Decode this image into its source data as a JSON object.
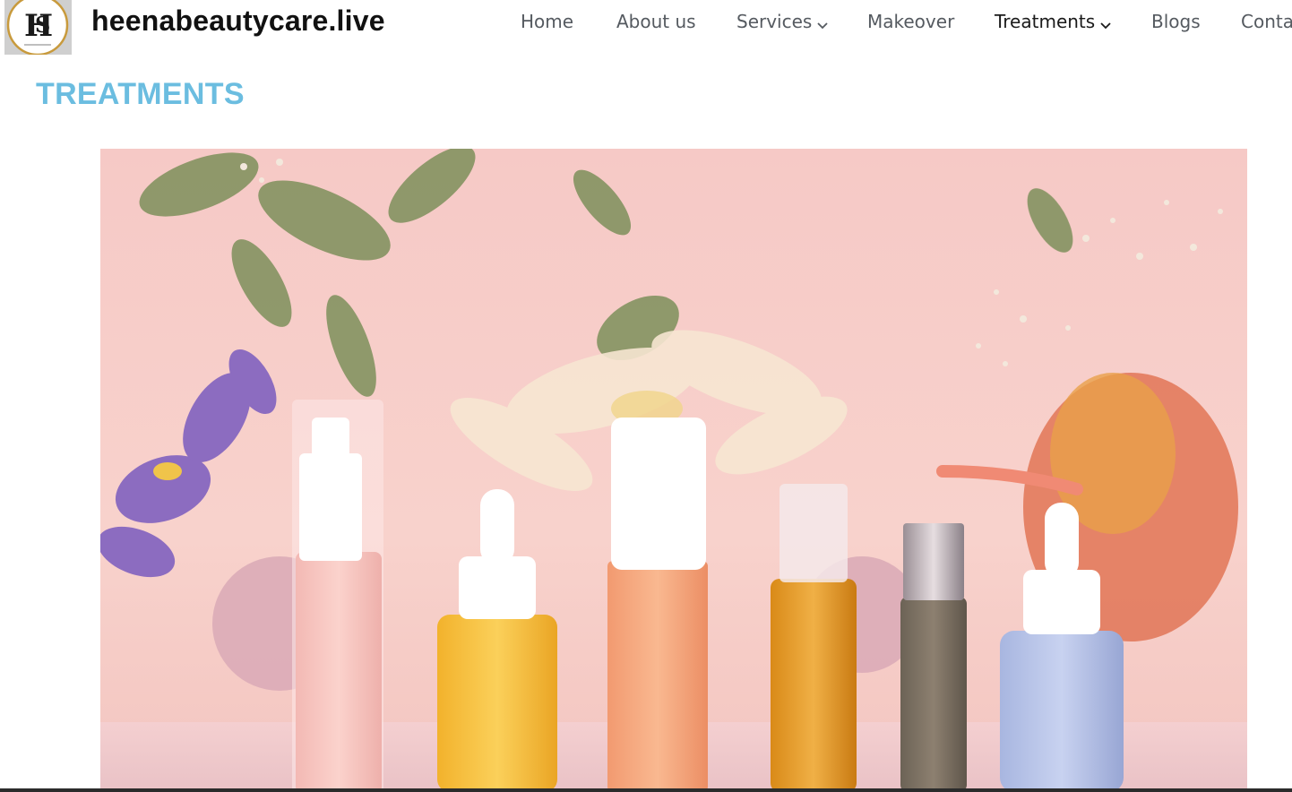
{
  "site": {
    "title": "heenabeautycare.live",
    "logo_alt": "HS beauty care logo"
  },
  "nav": {
    "items": [
      {
        "label": "Home",
        "has_dropdown": false
      },
      {
        "label": "About us",
        "has_dropdown": false
      },
      {
        "label": "Services",
        "has_dropdown": true
      },
      {
        "label": "Makeover",
        "has_dropdown": false
      },
      {
        "label": "Treatments",
        "has_dropdown": true,
        "active": true
      },
      {
        "label": "Blogs",
        "has_dropdown": false
      },
      {
        "label": "Conta",
        "has_dropdown": false
      }
    ]
  },
  "page": {
    "heading": "TREATMENTS"
  },
  "hero": {
    "description_icon": "skincare-products-image"
  },
  "colors": {
    "heading": "#6bbde0",
    "nav_text": "#555a60",
    "nav_active": "#1a1a1a",
    "title": "#111111"
  }
}
